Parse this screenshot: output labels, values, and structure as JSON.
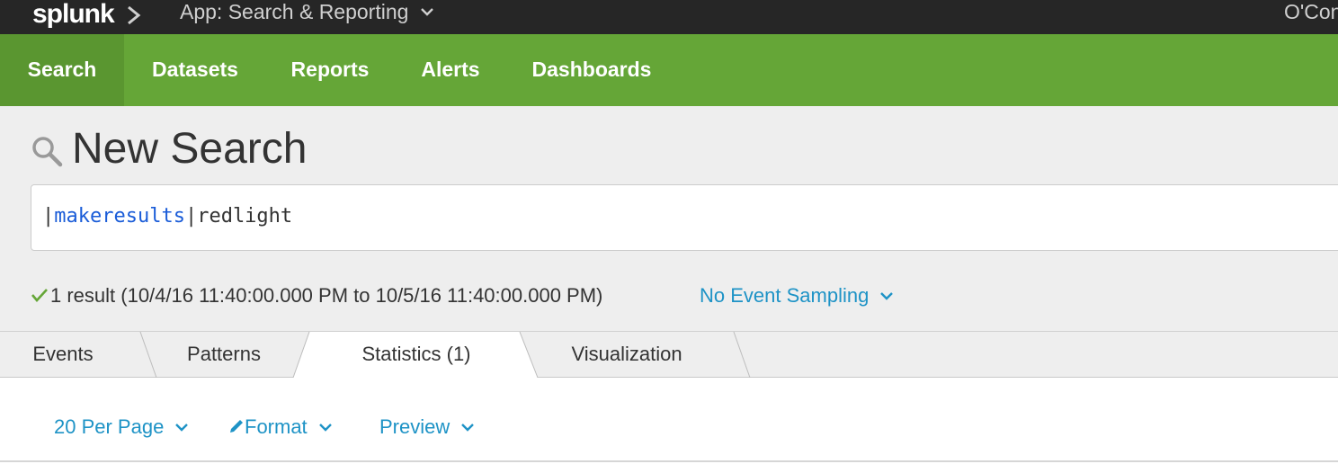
{
  "brand": {
    "logo_text": "splunk"
  },
  "topbar": {
    "app_menu_label": "App: Search & Reporting",
    "user_label": "O'Con"
  },
  "nav": {
    "items": [
      {
        "label": "Search",
        "active": true
      },
      {
        "label": "Datasets",
        "active": false
      },
      {
        "label": "Reports",
        "active": false
      },
      {
        "label": "Alerts",
        "active": false
      },
      {
        "label": "Dashboards",
        "active": false
      }
    ]
  },
  "search": {
    "title": "New Search",
    "query": {
      "pipe1": "|",
      "command": "makeresults",
      "pipe2": "|",
      "rest": "redlight"
    },
    "status_text": "1 result (10/4/16 11:40:00.000 PM to 10/5/16 11:40:00.000 PM)",
    "sampling_label": "No Event Sampling"
  },
  "tabs": [
    {
      "label": "Events",
      "active": false
    },
    {
      "label": "Patterns",
      "active": false
    },
    {
      "label": "Statistics (1)",
      "active": true
    },
    {
      "label": "Visualization",
      "active": false
    }
  ],
  "results_toolbar": {
    "per_page_label": "20 Per Page",
    "format_label": "Format",
    "preview_label": "Preview"
  },
  "colors": {
    "topbar": "#262626",
    "nav_green": "#65a637",
    "nav_active": "#5a9630",
    "link_blue": "#1e93c6",
    "command_blue": "#1a5cd8",
    "check_green": "#65a637"
  },
  "icons": {
    "title": "search-icon",
    "status": "check-icon",
    "format": "pencil-icon",
    "dropdown": "chevron-down-icon"
  }
}
